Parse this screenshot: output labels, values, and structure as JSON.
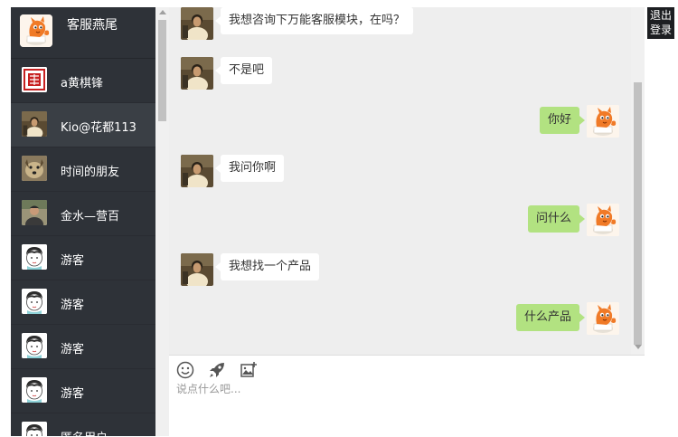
{
  "current_user": {
    "name": "客服燕尾",
    "avatar_icon": "orange-fox-mascot-icon"
  },
  "contacts": [
    {
      "name": "a黄棋锋",
      "avatar_icon": "red-seal-avatar-icon",
      "active": false
    },
    {
      "name": "Kio@花都113",
      "avatar_icon": "person-photo-avatar-icon",
      "active": true
    },
    {
      "name": "时间的朋友",
      "avatar_icon": "dog-photo-avatar-icon",
      "active": false
    },
    {
      "name": "金水—营百",
      "avatar_icon": "man-photo-avatar-icon",
      "active": false
    },
    {
      "name": "游客",
      "avatar_icon": "cartoon-boy-avatar-icon",
      "active": false
    },
    {
      "name": "游客",
      "avatar_icon": "cartoon-boy-avatar-icon",
      "active": false
    },
    {
      "name": "游客",
      "avatar_icon": "cartoon-boy-avatar-icon",
      "active": false
    },
    {
      "name": "游客",
      "avatar_icon": "cartoon-boy-avatar-icon",
      "active": false
    },
    {
      "name": "匿名用户",
      "avatar_icon": "cartoon-boy-avatar-icon",
      "active": false
    }
  ],
  "messages": [
    {
      "side": "left",
      "text": "我想咨询下万能客服模块，在吗？"
    },
    {
      "side": "left",
      "text": "不是吧"
    },
    {
      "side": "right",
      "text": "你好"
    },
    {
      "side": "left",
      "text": "我问你啊"
    },
    {
      "side": "right",
      "text": "问什么"
    },
    {
      "side": "left",
      "text": "我想找一个产品"
    },
    {
      "side": "right",
      "text": "什么产品"
    }
  ],
  "toolbar": {
    "emoji_icon": "smiley-face-icon",
    "send_icon": "rocket-icon",
    "image_icon": "image-add-icon"
  },
  "composer": {
    "placeholder": "说点什么吧..."
  },
  "logout": {
    "line1": "退出",
    "line2": "登录"
  },
  "colors": {
    "sidebar_bg": "#2e3238",
    "chat_bg": "#eeeeee",
    "bubble_right": "#b2e281",
    "bubble_left": "#ffffff",
    "accent_orange": "#f07a27"
  }
}
